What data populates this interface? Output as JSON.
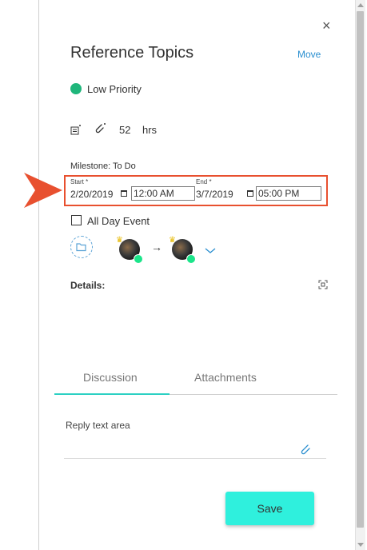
{
  "header": {
    "title": "Reference Topics",
    "move_label": "Move",
    "close_glyph": "×"
  },
  "priority": {
    "label": "Low Priority",
    "color": "#1fb67b"
  },
  "stats": {
    "hours": "52",
    "hours_unit": "hrs",
    "icons": [
      "notes-icon",
      "attachment-icon"
    ]
  },
  "milestone": {
    "label": "Milestone: To Do"
  },
  "schedule": {
    "start_label": "Start *",
    "start_date": "2/20/2019",
    "start_time": "12:00 AM",
    "end_label": "End *",
    "end_date": "3/7/2019",
    "end_time": "05:00 PM",
    "highlight_color": "#e8502f"
  },
  "all_day": {
    "label": "All Day Event",
    "checked": false
  },
  "assignees": {
    "arrow": "→",
    "online_color": "#1be58a"
  },
  "details": {
    "label": "Details:"
  },
  "tabs": [
    {
      "label": "Discussion",
      "active": true
    },
    {
      "label": "Attachments",
      "active": false
    }
  ],
  "reply": {
    "placeholder": "Reply text area"
  },
  "actions": {
    "save_label": "Save",
    "save_color": "#2ff0dd"
  }
}
